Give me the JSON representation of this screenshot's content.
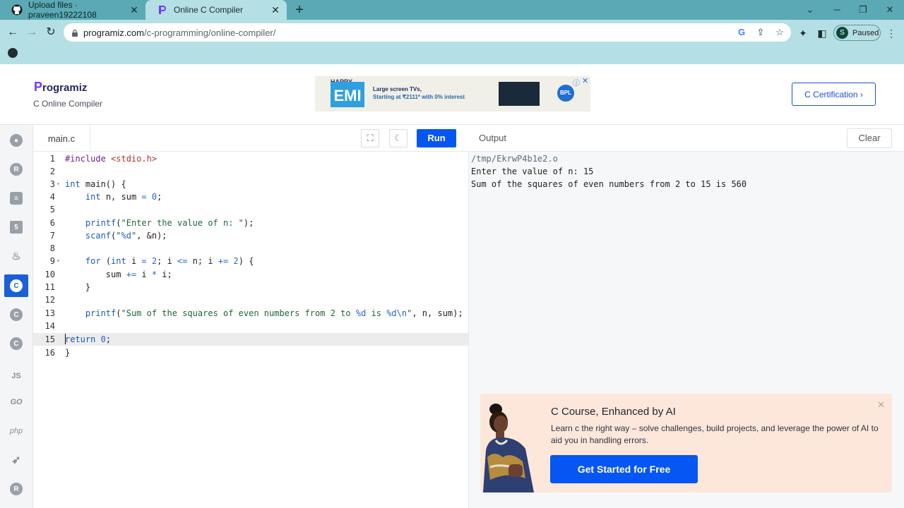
{
  "browser": {
    "tabs": [
      {
        "title": "Upload files · praveen19222108",
        "icon": "github-icon"
      },
      {
        "title": "Online C Compiler",
        "icon": "programiz-icon"
      }
    ],
    "url_domain": "programiz.com",
    "url_path": "/c-programming/online-compiler/",
    "profile_initial": "S",
    "profile_status": "Paused"
  },
  "site": {
    "logo_p": "P",
    "logo_rest": "rogramiz",
    "subtitle": "C Online Compiler",
    "certification_btn": "C Certification ›",
    "ad": {
      "happy": "HAPPY",
      "emi": "EMI",
      "line1": "Large screen TVs,",
      "line2": "Starting at ₹2111* with 0% interest",
      "brand": "BPL"
    }
  },
  "sidebar": {
    "languages": [
      "python",
      "r",
      "sql",
      "html",
      "java",
      "c",
      "cpp",
      "csharp",
      "js",
      "go",
      "php",
      "swift",
      "rust"
    ],
    "active": "c",
    "labels": {
      "js": "JS",
      "go": "GO",
      "php": "php"
    }
  },
  "editor": {
    "file_name": "main.c",
    "run_label": "Run",
    "highlighted_line": 15,
    "lines": [
      "#include <stdio.h>",
      "",
      "int main() {",
      "    int n, sum = 0;",
      "",
      "    printf(\"Enter the value of n: \");",
      "    scanf(\"%d\", &n);",
      "",
      "    for (int i = 2; i <= n; i += 2) {",
      "        sum += i * i;",
      "    }",
      "",
      "    printf(\"Sum of the squares of even numbers from 2 to %d is %d\\n\", n, sum);",
      "",
      "return 0;",
      "}"
    ]
  },
  "output": {
    "title": "Output",
    "clear_label": "Clear",
    "lines": [
      "/tmp/EkrwP4b1e2.o",
      "Enter the value of n: 15",
      "Sum of the squares of even numbers from 2 to 15 is 560"
    ]
  },
  "promo": {
    "title": "C Course, Enhanced by AI",
    "description": "Learn c the right way – solve challenges, build projects, and leverage the power of AI to aid you in handling errors.",
    "button": "Get Started for Free"
  },
  "colors": {
    "accent": "#0556f3",
    "tab_bar": "#5aa9b4",
    "toolbar": "#b4dfe5",
    "promo_bg": "#fde7db"
  }
}
